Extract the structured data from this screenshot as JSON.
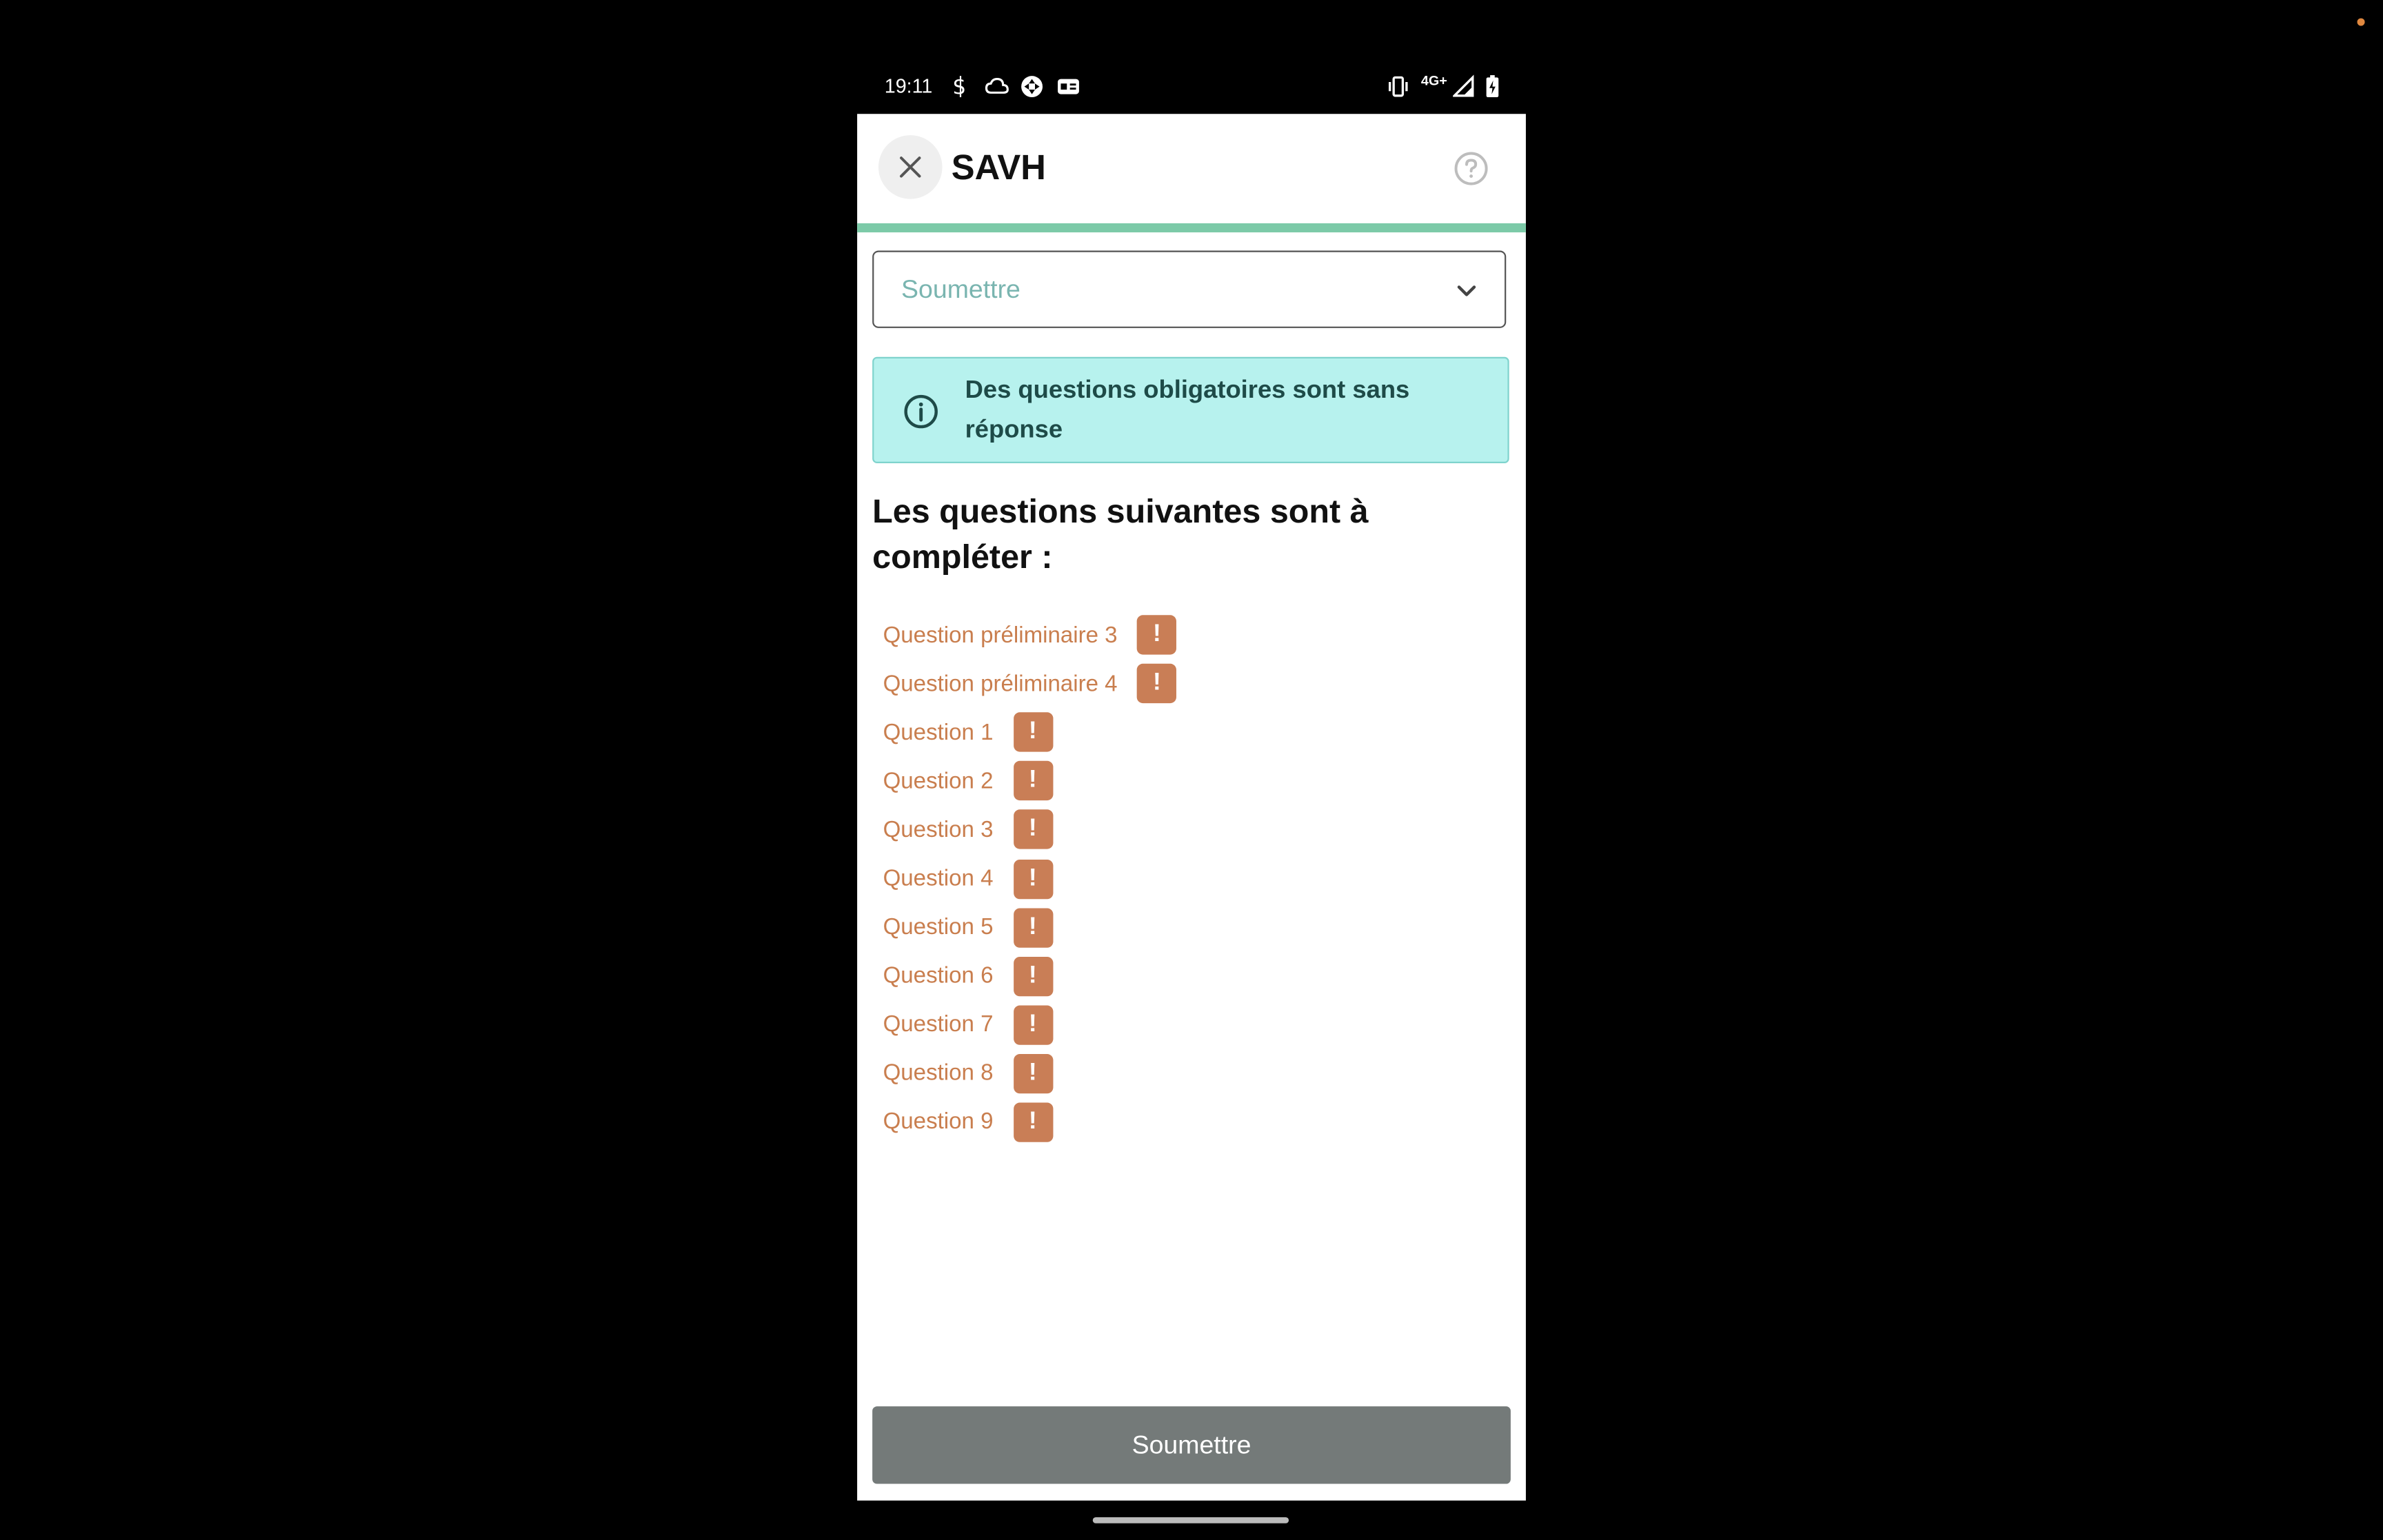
{
  "status_bar": {
    "time": "19:11",
    "network": "4G+"
  },
  "header": {
    "title": "SAVH"
  },
  "progress": {
    "fraction": 1.0
  },
  "select": {
    "value": "Soumettre"
  },
  "info_banner": {
    "message": "Des questions obligatoires sont sans réponse"
  },
  "section": {
    "heading": "Les questions suivantes sont à compléter :"
  },
  "questions": [
    {
      "label": "Question préliminaire 3",
      "badge": "!"
    },
    {
      "label": "Question préliminaire 4",
      "badge": "!"
    },
    {
      "label": "Question 1",
      "badge": "!"
    },
    {
      "label": "Question 2",
      "badge": "!"
    },
    {
      "label": "Question 3",
      "badge": "!"
    },
    {
      "label": "Question 4",
      "badge": "!"
    },
    {
      "label": "Question 5",
      "badge": "!"
    },
    {
      "label": "Question 6",
      "badge": "!"
    },
    {
      "label": "Question 7",
      "badge": "!"
    },
    {
      "label": "Question 8",
      "badge": "!"
    },
    {
      "label": "Question 9",
      "badge": "!"
    }
  ],
  "footer": {
    "submit_label": "Soumettre"
  },
  "colors": {
    "accent": "#7ccaa8",
    "warning": "#c97e56",
    "info_bg": "#b7f2ee",
    "button_disabled": "#747a79"
  },
  "icons": {
    "close": "close-icon",
    "help": "help-circle-icon",
    "chevron": "chevron-down-icon",
    "info": "info-circle-icon"
  }
}
